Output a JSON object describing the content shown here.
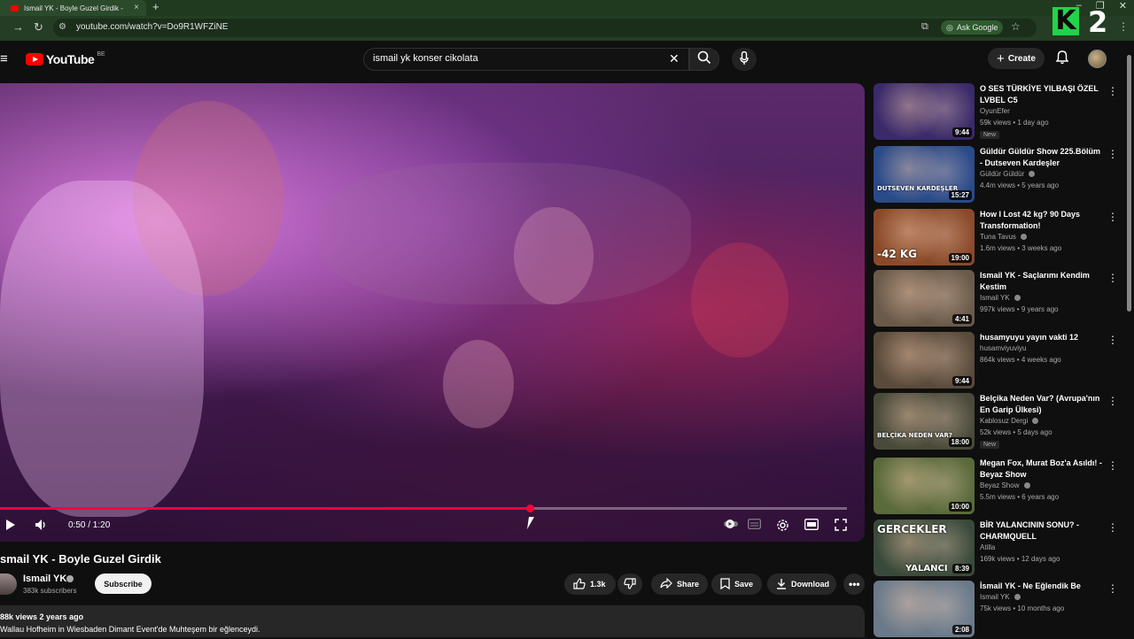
{
  "browser": {
    "tab_title": "Ismail YK - Boyle Guzel Girdik -",
    "tab_close": "×",
    "new_tab": "+",
    "url": "youtube.com/watch?v=Do9R1WFZiNE",
    "ask_google": "Ask Google",
    "watermark": "K 2"
  },
  "header": {
    "logo_text": "YouTube",
    "country_code": "BE",
    "search_value": "ismail yk konser cikolata",
    "create_label": "Create"
  },
  "player": {
    "current_time": "0:50 / 1:20",
    "progress": 0.625
  },
  "video": {
    "title": "smail YK - Boyle Guzel Girdik",
    "channel_name": "Ismail YK",
    "subscribers": "383k subscribers",
    "subscribe_label": "Subscribe",
    "likes": "1.3k",
    "share_label": "Share",
    "save_label": "Save",
    "download_label": "Download",
    "desc_stats": "88k views  2 years ago",
    "desc_text": "Wallau Hofheim in Wiesbaden Dimant Event'de Muhteşem bir eğlenceydi."
  },
  "recommendations": [
    {
      "title": "O SES TÜRKİYE YILBAŞI ÖZEL LVBEL C5",
      "channel": "OyunEfer",
      "meta": "59k views • 1 day ago",
      "badge": "New",
      "duration": "9:44",
      "verified": false,
      "thumb_color": "#3a2a6a"
    },
    {
      "title": "Güldür Güldür Show 225.Bölüm - Dutseven Kardeşler",
      "channel": "Güldür Güldür",
      "meta": "4.4m views • 5 years ago",
      "badge": "",
      "duration": "15:27",
      "verified": true,
      "thumb_color": "#2a4a8a",
      "thumb_label": "DUTSEVEN KARDEŞLER"
    },
    {
      "title": "How I Lost 42 kg? 90 Days Transformation!",
      "channel": "Tuna Tavus",
      "meta": "1.6m views • 3 weeks ago",
      "badge": "",
      "duration": "19:00",
      "verified": true,
      "thumb_color": "#8a4a2a",
      "thumb_label": "-42 KG"
    },
    {
      "title": "Ismail YK -  Saçlarımı Kendim Kestim",
      "channel": "Ismail YK",
      "meta": "997k views • 9 years ago",
      "badge": "",
      "duration": "4:41",
      "verified": true,
      "thumb_color": "#6a5a4a"
    },
    {
      "title": "husamyuyu yayın vakti 12",
      "channel": "husamviyuviyu",
      "meta": "864k views • 4 weeks ago",
      "badge": "",
      "duration": "9:44",
      "verified": false,
      "thumb_color": "#5a4a3a"
    },
    {
      "title": "Belçika Neden Var? (Avrupa'nın En Garip Ülkesi)",
      "channel": "Kablosuz Dergi",
      "meta": "52k views • 5 days ago",
      "badge": "New",
      "duration": "18:00",
      "verified": true,
      "thumb_color": "#4a4a3a",
      "thumb_label": "BELÇİKA NEDEN VAR?"
    },
    {
      "title": "Megan Fox, Murat Boz'a Asıldı! - Beyaz Show",
      "channel": "Beyaz Show",
      "meta": "5.5m views • 6 years ago",
      "badge": "",
      "duration": "10:00",
      "verified": true,
      "thumb_color": "#5a6a3a"
    },
    {
      "title": "BİR YALANCININ SONU? - CHARMQUELL",
      "channel": "Atilla",
      "meta": "169k views • 12 days ago",
      "badge": "",
      "duration": "8:39",
      "verified": false,
      "thumb_color": "#3a4a3a",
      "thumb_label": "GERCEKLER",
      "thumb_label2": "YALANCI"
    },
    {
      "title": "İsmail YK - Ne Eğlendik Be",
      "channel": "Ismail YK",
      "meta": "75k views • 10 months ago",
      "badge": "",
      "duration": "2:08",
      "verified": true,
      "thumb_color": "#6a7a8a"
    }
  ],
  "icons": {
    "menu": "≡",
    "search": "⌕",
    "mic": "🎤",
    "bell": "🔔",
    "close": "✕",
    "more": "⋮",
    "play": "▶",
    "volume": "🔊"
  }
}
